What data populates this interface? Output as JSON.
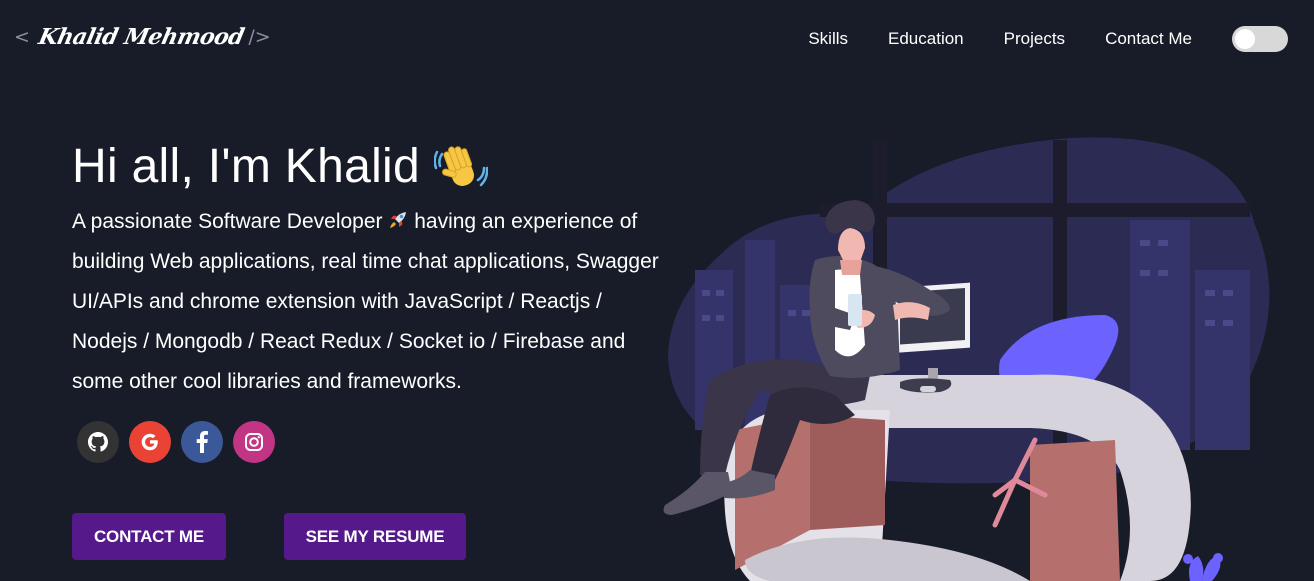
{
  "header": {
    "logo": {
      "open_bracket": "<",
      "signature": "Khalid Mehmood",
      "close_bracket": "/>"
    },
    "nav": [
      {
        "label": "Skills"
      },
      {
        "label": "Education"
      },
      {
        "label": "Projects"
      },
      {
        "label": "Contact Me"
      }
    ],
    "theme_toggle": {
      "state": "off"
    }
  },
  "hero": {
    "greeting": "Hi all, I'm Khalid",
    "greeting_emoji": "waving-hand-icon",
    "intro_part1": "A passionate Software Developer",
    "intro_emoji": "rocket-icon",
    "intro_part2": "having an experience of building Web applications, real time chat applications, Swagger UI/APIs and chrome extension with JavaScript / Reactjs / Nodejs / Mongodb / React Redux / Socket io / Firebase and some other cool libraries and frameworks."
  },
  "social": [
    {
      "icon": "github-icon",
      "color": "#333333"
    },
    {
      "icon": "google-icon",
      "color": "#ea4335"
    },
    {
      "icon": "facebook-icon",
      "color": "#3b5998"
    },
    {
      "icon": "instagram-icon",
      "color": "#c13584"
    }
  ],
  "buttons": {
    "contact": "CONTACT ME",
    "resume": "SEE MY RESUME"
  },
  "colors": {
    "background": "#171c28",
    "button": "#55198b",
    "toggle": "#d8d8d8"
  }
}
